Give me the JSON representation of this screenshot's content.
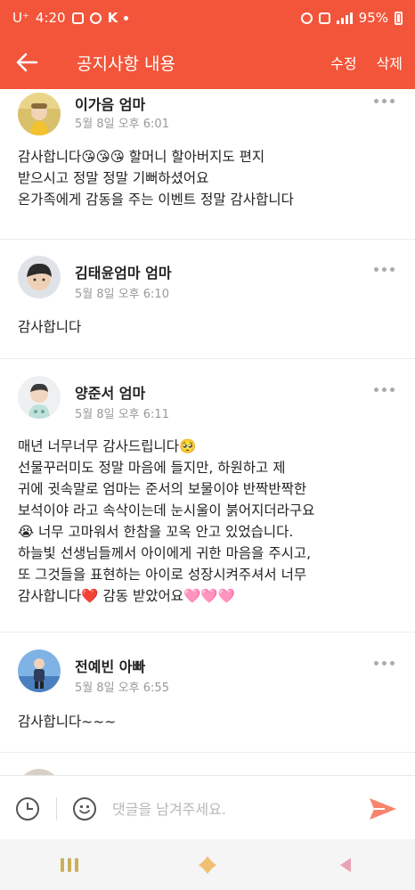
{
  "status_bar": {
    "carrier": "U⁺",
    "time": "4:20",
    "battery": "95%"
  },
  "app_bar": {
    "title": "공지사항 내용",
    "edit_label": "수정",
    "delete_label": "삭제"
  },
  "comments": [
    {
      "author": "이가음 엄마",
      "date": "5월 8일 오후 6:01",
      "text": "감사합니다😘😘😘 할머니 할아버지도 편지\n받으시고 정말 정말 기뻐하셨어요\n온가족에게 감동을 주는 이벤트 정말 감사합니다"
    },
    {
      "author": "김태윤엄마 엄마",
      "date": "5월 8일 오후 6:10",
      "text": "감사합니다"
    },
    {
      "author": "양준서 엄마",
      "date": "5월 8일 오후 6:11",
      "text": "매년 너무너무 감사드립니다🥺\n선물꾸러미도 정말 마음에 들지만, 하원하고 제\n귀에 귓속말로 엄마는 준서의 보물이야 반짝반짝한\n보석이야 라고 속삭이는데 눈시울이 붉어지더라구요\n😭 너무 고마워서 한참을 꼬옥 안고 있었습니다.\n하늘빛 선생님들께서 아이에게 귀한 마음을 주시고,\n또 그것들을 표현하는 아이로 성장시켜주셔서 너무\n감사합니다❤️ 감동 받았어요🩷🩷🩷"
    },
    {
      "author": "전예빈 아빠",
      "date": "5월 8일 오후 6:55",
      "text": "감사합니다~~~"
    }
  ],
  "input_bar": {
    "placeholder": "댓글을 남겨주세요."
  },
  "colors": {
    "accent": "#f2553a",
    "send": "#f7856e"
  },
  "icons": [
    "back-arrow-icon",
    "more-icon",
    "clock-icon",
    "emoji-icon",
    "send-icon",
    "recent-apps-icon",
    "home-icon",
    "back-triangle-icon"
  ]
}
